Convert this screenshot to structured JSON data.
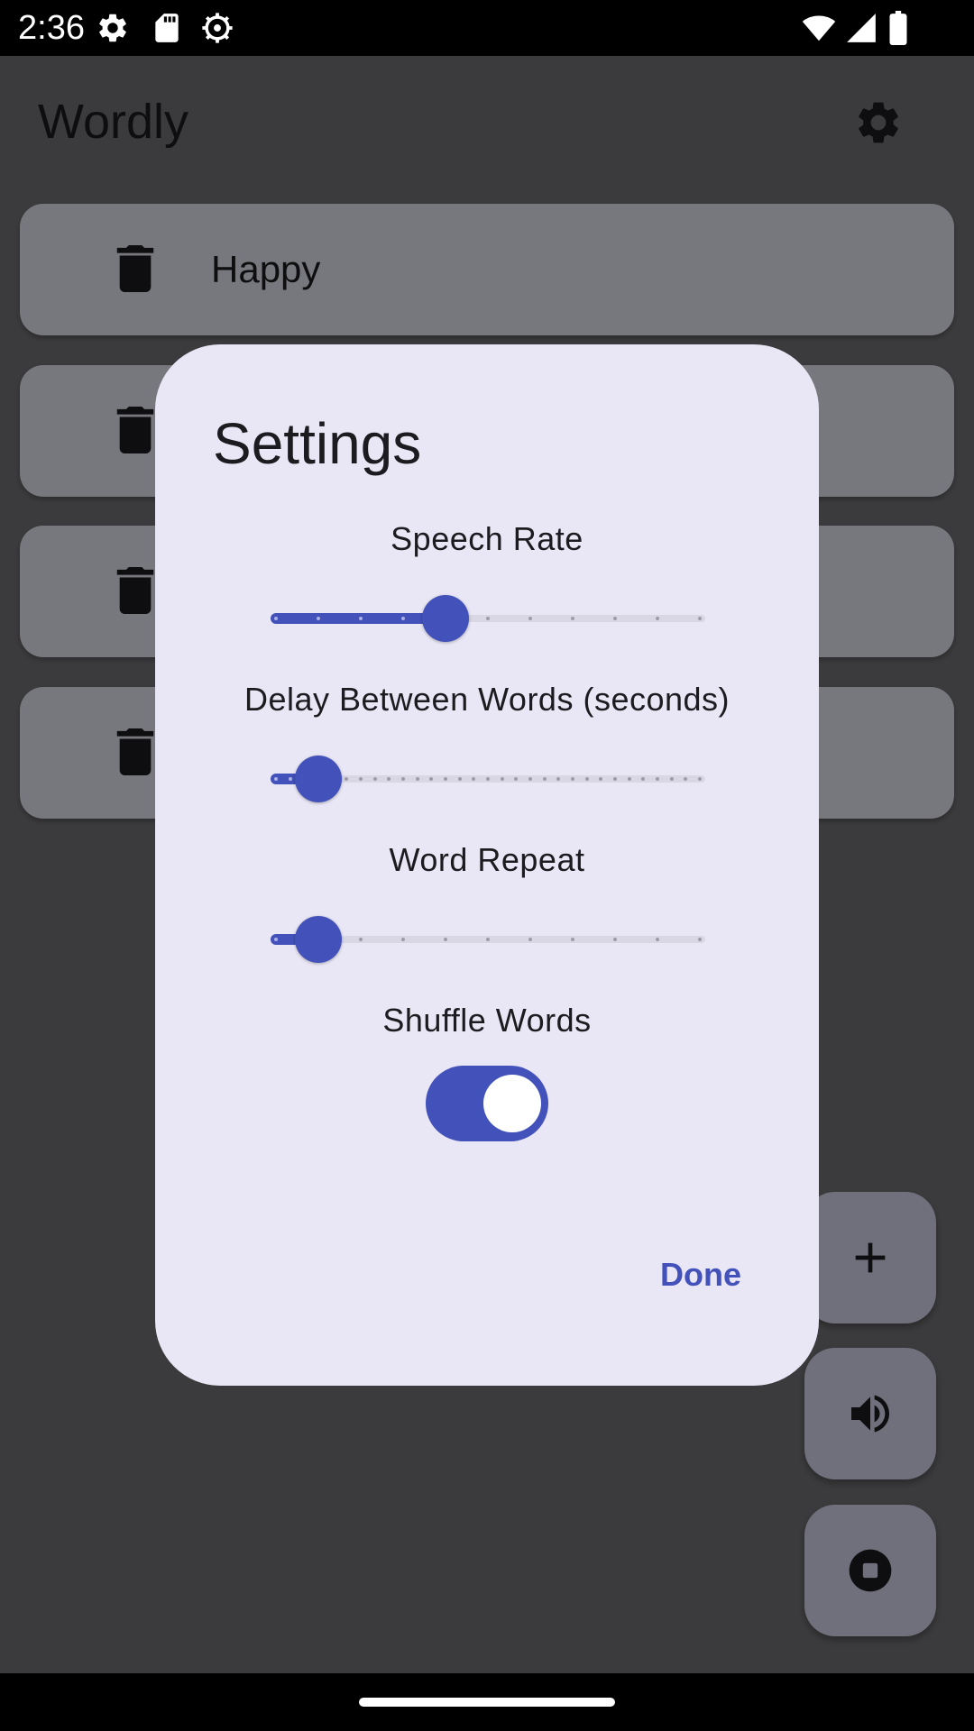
{
  "status_bar": {
    "time": "2:36",
    "icons": [
      "gear-icon",
      "sd-card-icon",
      "debug-gear-icon",
      "wifi-icon",
      "signal-icon",
      "battery-icon"
    ]
  },
  "app": {
    "title": "Wordly",
    "settings_icon": "gear-icon",
    "words": [
      {
        "text": "Happy",
        "delete_icon": "trash-icon"
      },
      {
        "text": "",
        "delete_icon": "trash-icon"
      },
      {
        "text": "",
        "delete_icon": "trash-icon"
      },
      {
        "text": "",
        "delete_icon": "trash-icon"
      }
    ],
    "fabs": [
      {
        "icon": "plus-icon"
      },
      {
        "icon": "speaker-icon"
      },
      {
        "icon": "stop-icon"
      }
    ]
  },
  "dialog": {
    "title": "Settings",
    "speech_rate": {
      "label": "Speech Rate",
      "divisions": 10,
      "value_fraction": 0.4
    },
    "delay": {
      "label": "Delay Between Words (seconds)",
      "divisions": 30,
      "value_fraction": 0.1
    },
    "word_repeat": {
      "label": "Word Repeat",
      "divisions": 10,
      "value_fraction": 0.1
    },
    "shuffle": {
      "label": "Shuffle Words",
      "on": true
    },
    "done_label": "Done"
  },
  "colors": {
    "accent": "#4352bb",
    "dialog_background": "#e9e7f5",
    "inactive_track": "#d8d7e3"
  }
}
